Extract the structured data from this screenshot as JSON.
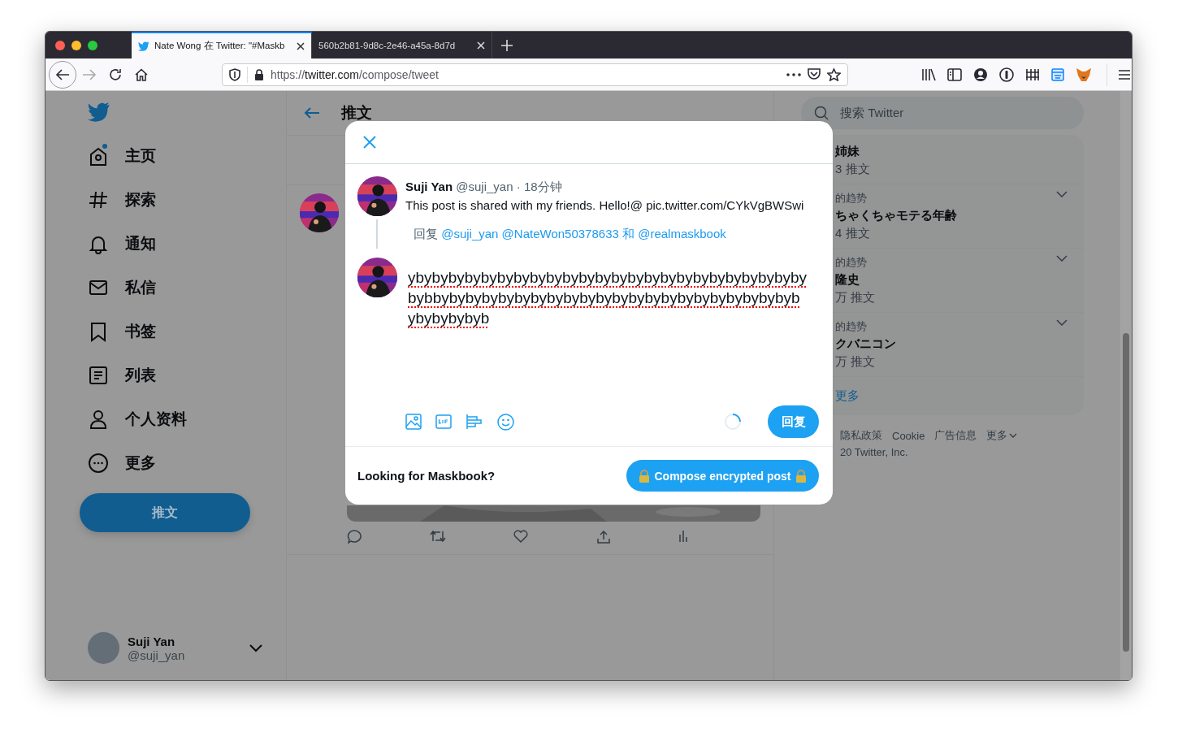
{
  "browser": {
    "tabs": [
      {
        "title": "Nate Wong 在 Twitter: \"#Maskb",
        "selected": true,
        "kind": "twitter"
      },
      {
        "title": "560b2b81-9d8c-2e46-a45a-8d7d",
        "selected": false,
        "kind": "blank"
      }
    ],
    "url": {
      "scheme": "https://",
      "host": "twitter.com",
      "path": "/compose/tweet"
    }
  },
  "sidebar": {
    "items": [
      {
        "label": "主页",
        "kind": "home",
        "has_new": true
      },
      {
        "label": "探索",
        "kind": "hash",
        "has_new": false
      },
      {
        "label": "通知",
        "kind": "bell",
        "has_new": false
      },
      {
        "label": "私信",
        "kind": "mail",
        "has_new": false
      },
      {
        "label": "书签",
        "kind": "bookmark",
        "has_new": false
      },
      {
        "label": "列表",
        "kind": "list",
        "has_new": false
      },
      {
        "label": "个人资料",
        "kind": "person",
        "has_new": false
      },
      {
        "label": "更多",
        "kind": "more",
        "has_new": false
      }
    ],
    "tweet_button": "推文",
    "account": {
      "name": "Suji Yan",
      "handle": "@suji_yan"
    }
  },
  "timeline": {
    "title": "推文"
  },
  "right": {
    "search_placeholder": "搜索 Twitter",
    "trends": [
      {
        "name": "姉妹",
        "count": "3 推文"
      },
      {
        "context": "的趋势",
        "name": "ちゃくちゃモテる年齢",
        "count": "4 推文"
      },
      {
        "context": "的趋势",
        "name": "隆史",
        "count": "万 推文"
      },
      {
        "context": "的趋势",
        "name": "クバニコン",
        "count": "万 推文"
      }
    ],
    "show_more": "更多",
    "footer_links": [
      "隐私政策",
      "Cookie",
      "广告信息",
      "更多"
    ],
    "copyright": "20 Twitter, Inc."
  },
  "modal": {
    "quoted": {
      "name": "Suji Yan",
      "handle": "@suji_yan",
      "separator": "·",
      "time": "18分钟",
      "text": "This post is shared with my friends. Hello!@ pic.twitter.com/CYkVgBWSwi"
    },
    "reply_prefix": "回复",
    "reply_mentions": "@suji_yan @NateWon50378633 和 @realmaskbook",
    "draft_lines": [
      "ybybybybybybybybybybybybybybybybybybybybybybybyby",
      "bybbybybybybybybybybybybybybybybybybybybybybybyb",
      "ybybybybyb"
    ],
    "counter": {
      "level": 0.25
    },
    "reply_button": "回复",
    "footer_text": "Looking for Maskbook?",
    "compose_button": "Compose encrypted post"
  }
}
